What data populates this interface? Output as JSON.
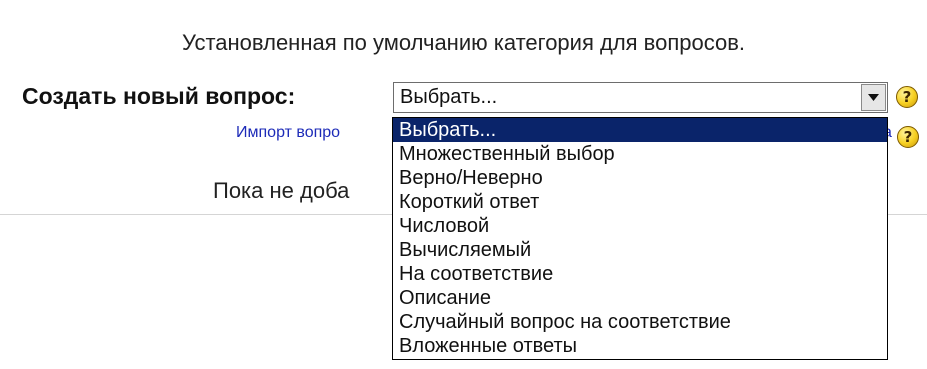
{
  "header": {
    "default_category_text": "Установленная по умолчанию категория для вопросов."
  },
  "create_question": {
    "label": "Создать новый вопрос:",
    "selected_value": "Выбрать...",
    "help_icon": "help-icon"
  },
  "import": {
    "link_text_visible": "Импорт вопро",
    "link_suffix_visible": "а",
    "help_icon": "help-icon"
  },
  "status": {
    "no_questions_text_visible": "Пока не доба"
  },
  "dropdown": {
    "options": [
      {
        "label": "Выбрать..."
      },
      {
        "label": "Множественный выбор"
      },
      {
        "label": "Верно/Неверно"
      },
      {
        "label": "Короткий ответ"
      },
      {
        "label": "Числовой"
      },
      {
        "label": "Вычисляемый"
      },
      {
        "label": "На соответствие"
      },
      {
        "label": "Описание"
      },
      {
        "label": "Случайный вопрос на соответствие"
      },
      {
        "label": "Вложенные ответы"
      }
    ]
  },
  "colors": {
    "link": "#1d2bb8",
    "selected_option_bg": "#0a246a",
    "selected_option_text": "#ffffff",
    "help_icon": "#f6cf21"
  }
}
